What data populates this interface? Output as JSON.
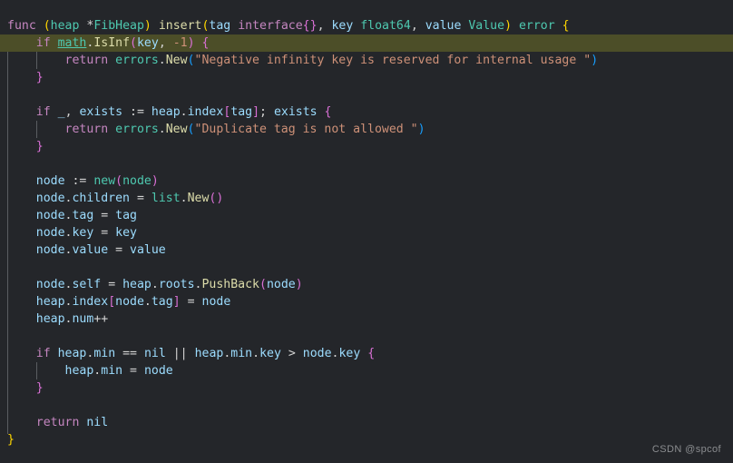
{
  "editor": {
    "language": "go",
    "background_color": "#24262a",
    "highlight_line_color": "#4c4e28",
    "highlighted_line_number": 2,
    "indent_guide_color": "#5a5d61",
    "line_height_px": 19,
    "font_size_px": 13.2
  },
  "watermark": {
    "text": "CSDN @spcof",
    "color": "#8b8d90"
  },
  "code": {
    "full_text": "func (heap *FibHeap) insert(tag interface{}, key float64, value Value) error {\n    if math.IsInf(key, -1) {\n        return errors.New(\"Negative infinity key is reserved for internal usage \")\n    }\n\n    if _, exists := heap.index[tag]; exists {\n        return errors.New(\"Duplicate tag is not allowed \")\n    }\n\n    node := new(node)\n    node.children = list.New()\n    node.tag = tag\n    node.key = key\n    node.value = value\n\n    node.self = heap.roots.PushBack(node)\n    heap.index[node.tag] = node\n    heap.num++\n\n    if heap.min == nil || heap.min.key > node.key {\n        heap.min = node\n    }\n\n    return nil\n}",
    "lines": [
      {
        "n": 1,
        "text": "func (heap *FibHeap) insert(tag interface{}, key float64, value Value) error {",
        "tokens": [
          {
            "t": "func",
            "c": "t-kw"
          },
          {
            "t": " ",
            "c": "t-plain"
          },
          {
            "t": "(",
            "c": "t-paren"
          },
          {
            "t": "heap",
            "c": "t-type"
          },
          {
            "t": " ",
            "c": "t-plain"
          },
          {
            "t": "*",
            "c": "t-plain"
          },
          {
            "t": "FibHeap",
            "c": "t-type"
          },
          {
            "t": ")",
            "c": "t-paren"
          },
          {
            "t": " ",
            "c": "t-plain"
          },
          {
            "t": "insert",
            "c": "t-func"
          },
          {
            "t": "(",
            "c": "t-paren"
          },
          {
            "t": "tag",
            "c": "t-var"
          },
          {
            "t": " ",
            "c": "t-plain"
          },
          {
            "t": "interface",
            "c": "t-iface"
          },
          {
            "t": "{}",
            "c": "t-brace"
          },
          {
            "t": ", ",
            "c": "t-op"
          },
          {
            "t": "key",
            "c": "t-var"
          },
          {
            "t": " ",
            "c": "t-plain"
          },
          {
            "t": "float64",
            "c": "t-type"
          },
          {
            "t": ", ",
            "c": "t-op"
          },
          {
            "t": "value",
            "c": "t-var"
          },
          {
            "t": " ",
            "c": "t-plain"
          },
          {
            "t": "Value",
            "c": "t-type"
          },
          {
            "t": ")",
            "c": "t-paren"
          },
          {
            "t": " ",
            "c": "t-plain"
          },
          {
            "t": "error",
            "c": "t-type"
          },
          {
            "t": " ",
            "c": "t-plain"
          },
          {
            "t": "{",
            "c": "t-brace-y"
          }
        ]
      },
      {
        "n": 2,
        "text": "    if math.IsInf(key, -1) {",
        "highlight": true,
        "tokens": [
          {
            "t": "    ",
            "c": "t-plain"
          },
          {
            "t": "if",
            "c": "t-kw"
          },
          {
            "t": " ",
            "c": "t-plain"
          },
          {
            "t": "math",
            "c": "t-pkg-link"
          },
          {
            "t": ".",
            "c": "t-plain"
          },
          {
            "t": "IsInf",
            "c": "t-func"
          },
          {
            "t": "(",
            "c": "t-paren2"
          },
          {
            "t": "key",
            "c": "t-var"
          },
          {
            "t": ", ",
            "c": "t-op"
          },
          {
            "t": "-1",
            "c": "t-str"
          },
          {
            "t": ")",
            "c": "t-paren2"
          },
          {
            "t": " ",
            "c": "t-plain"
          },
          {
            "t": "{",
            "c": "t-brace"
          }
        ]
      },
      {
        "n": 3,
        "text": "        return errors.New(\"Negative infinity key is reserved for internal usage \")",
        "tokens": [
          {
            "t": "        ",
            "c": "t-plain"
          },
          {
            "t": "return",
            "c": "t-kw"
          },
          {
            "t": " ",
            "c": "t-plain"
          },
          {
            "t": "errors",
            "c": "t-type"
          },
          {
            "t": ".",
            "c": "t-plain"
          },
          {
            "t": "New",
            "c": "t-func"
          },
          {
            "t": "(",
            "c": "t-paren3"
          },
          {
            "t": "\"Negative infinity key is reserved for internal usage \"",
            "c": "t-str"
          },
          {
            "t": ")",
            "c": "t-paren3"
          }
        ]
      },
      {
        "n": 4,
        "text": "    }",
        "tokens": [
          {
            "t": "    ",
            "c": "t-plain"
          },
          {
            "t": "}",
            "c": "t-brace"
          }
        ]
      },
      {
        "n": 5,
        "text": "",
        "tokens": []
      },
      {
        "n": 6,
        "text": "    if _, exists := heap.index[tag]; exists {",
        "tokens": [
          {
            "t": "    ",
            "c": "t-plain"
          },
          {
            "t": "if",
            "c": "t-kw"
          },
          {
            "t": " ",
            "c": "t-plain"
          },
          {
            "t": "_",
            "c": "t-var"
          },
          {
            "t": ", ",
            "c": "t-op"
          },
          {
            "t": "exists",
            "c": "t-var"
          },
          {
            "t": " ",
            "c": "t-plain"
          },
          {
            "t": ":=",
            "c": "t-op"
          },
          {
            "t": " ",
            "c": "t-plain"
          },
          {
            "t": "heap",
            "c": "t-var"
          },
          {
            "t": ".",
            "c": "t-plain"
          },
          {
            "t": "index",
            "c": "t-var"
          },
          {
            "t": "[",
            "c": "t-paren2"
          },
          {
            "t": "tag",
            "c": "t-var"
          },
          {
            "t": "]",
            "c": "t-paren2"
          },
          {
            "t": "; ",
            "c": "t-op"
          },
          {
            "t": "exists",
            "c": "t-var"
          },
          {
            "t": " ",
            "c": "t-plain"
          },
          {
            "t": "{",
            "c": "t-brace"
          }
        ]
      },
      {
        "n": 7,
        "text": "        return errors.New(\"Duplicate tag is not allowed \")",
        "tokens": [
          {
            "t": "        ",
            "c": "t-plain"
          },
          {
            "t": "return",
            "c": "t-kw"
          },
          {
            "t": " ",
            "c": "t-plain"
          },
          {
            "t": "errors",
            "c": "t-type"
          },
          {
            "t": ".",
            "c": "t-plain"
          },
          {
            "t": "New",
            "c": "t-func"
          },
          {
            "t": "(",
            "c": "t-paren3"
          },
          {
            "t": "\"Duplicate tag is not allowed \"",
            "c": "t-str"
          },
          {
            "t": ")",
            "c": "t-paren3"
          }
        ]
      },
      {
        "n": 8,
        "text": "    }",
        "tokens": [
          {
            "t": "    ",
            "c": "t-plain"
          },
          {
            "t": "}",
            "c": "t-brace"
          }
        ]
      },
      {
        "n": 9,
        "text": "",
        "tokens": []
      },
      {
        "n": 10,
        "text": "    node := new(node)",
        "tokens": [
          {
            "t": "    ",
            "c": "t-plain"
          },
          {
            "t": "node",
            "c": "t-var"
          },
          {
            "t": " ",
            "c": "t-plain"
          },
          {
            "t": ":=",
            "c": "t-op"
          },
          {
            "t": " ",
            "c": "t-plain"
          },
          {
            "t": "new",
            "c": "t-type"
          },
          {
            "t": "(",
            "c": "t-paren2"
          },
          {
            "t": "node",
            "c": "t-type"
          },
          {
            "t": ")",
            "c": "t-paren2"
          }
        ]
      },
      {
        "n": 11,
        "text": "    node.children = list.New()",
        "tokens": [
          {
            "t": "    ",
            "c": "t-plain"
          },
          {
            "t": "node",
            "c": "t-var"
          },
          {
            "t": ".",
            "c": "t-plain"
          },
          {
            "t": "children",
            "c": "t-var"
          },
          {
            "t": " ",
            "c": "t-plain"
          },
          {
            "t": "=",
            "c": "t-op"
          },
          {
            "t": " ",
            "c": "t-plain"
          },
          {
            "t": "list",
            "c": "t-type"
          },
          {
            "t": ".",
            "c": "t-plain"
          },
          {
            "t": "New",
            "c": "t-func"
          },
          {
            "t": "()",
            "c": "t-paren2"
          }
        ]
      },
      {
        "n": 12,
        "text": "    node.tag = tag",
        "tokens": [
          {
            "t": "    ",
            "c": "t-plain"
          },
          {
            "t": "node",
            "c": "t-var"
          },
          {
            "t": ".",
            "c": "t-plain"
          },
          {
            "t": "tag",
            "c": "t-var"
          },
          {
            "t": " ",
            "c": "t-plain"
          },
          {
            "t": "=",
            "c": "t-op"
          },
          {
            "t": " ",
            "c": "t-plain"
          },
          {
            "t": "tag",
            "c": "t-var"
          }
        ]
      },
      {
        "n": 13,
        "text": "    node.key = key",
        "tokens": [
          {
            "t": "    ",
            "c": "t-plain"
          },
          {
            "t": "node",
            "c": "t-var"
          },
          {
            "t": ".",
            "c": "t-plain"
          },
          {
            "t": "key",
            "c": "t-var"
          },
          {
            "t": " ",
            "c": "t-plain"
          },
          {
            "t": "=",
            "c": "t-op"
          },
          {
            "t": " ",
            "c": "t-plain"
          },
          {
            "t": "key",
            "c": "t-var"
          }
        ]
      },
      {
        "n": 14,
        "text": "    node.value = value",
        "tokens": [
          {
            "t": "    ",
            "c": "t-plain"
          },
          {
            "t": "node",
            "c": "t-var"
          },
          {
            "t": ".",
            "c": "t-plain"
          },
          {
            "t": "value",
            "c": "t-var"
          },
          {
            "t": " ",
            "c": "t-plain"
          },
          {
            "t": "=",
            "c": "t-op"
          },
          {
            "t": " ",
            "c": "t-plain"
          },
          {
            "t": "value",
            "c": "t-var"
          }
        ]
      },
      {
        "n": 15,
        "text": "",
        "tokens": []
      },
      {
        "n": 16,
        "text": "    node.self = heap.roots.PushBack(node)",
        "tokens": [
          {
            "t": "    ",
            "c": "t-plain"
          },
          {
            "t": "node",
            "c": "t-var"
          },
          {
            "t": ".",
            "c": "t-plain"
          },
          {
            "t": "self",
            "c": "t-var"
          },
          {
            "t": " ",
            "c": "t-plain"
          },
          {
            "t": "=",
            "c": "t-op"
          },
          {
            "t": " ",
            "c": "t-plain"
          },
          {
            "t": "heap",
            "c": "t-var"
          },
          {
            "t": ".",
            "c": "t-plain"
          },
          {
            "t": "roots",
            "c": "t-var"
          },
          {
            "t": ".",
            "c": "t-plain"
          },
          {
            "t": "PushBack",
            "c": "t-func"
          },
          {
            "t": "(",
            "c": "t-paren2"
          },
          {
            "t": "node",
            "c": "t-var"
          },
          {
            "t": ")",
            "c": "t-paren2"
          }
        ]
      },
      {
        "n": 17,
        "text": "    heap.index[node.tag] = node",
        "tokens": [
          {
            "t": "    ",
            "c": "t-plain"
          },
          {
            "t": "heap",
            "c": "t-var"
          },
          {
            "t": ".",
            "c": "t-plain"
          },
          {
            "t": "index",
            "c": "t-var"
          },
          {
            "t": "[",
            "c": "t-paren2"
          },
          {
            "t": "node",
            "c": "t-var"
          },
          {
            "t": ".",
            "c": "t-plain"
          },
          {
            "t": "tag",
            "c": "t-var"
          },
          {
            "t": "]",
            "c": "t-paren2"
          },
          {
            "t": " ",
            "c": "t-plain"
          },
          {
            "t": "=",
            "c": "t-op"
          },
          {
            "t": " ",
            "c": "t-plain"
          },
          {
            "t": "node",
            "c": "t-var"
          }
        ]
      },
      {
        "n": 18,
        "text": "    heap.num++",
        "tokens": [
          {
            "t": "    ",
            "c": "t-plain"
          },
          {
            "t": "heap",
            "c": "t-var"
          },
          {
            "t": ".",
            "c": "t-plain"
          },
          {
            "t": "num",
            "c": "t-var"
          },
          {
            "t": "++",
            "c": "t-op"
          }
        ]
      },
      {
        "n": 19,
        "text": "",
        "tokens": []
      },
      {
        "n": 20,
        "text": "    if heap.min == nil || heap.min.key > node.key {",
        "tokens": [
          {
            "t": "    ",
            "c": "t-plain"
          },
          {
            "t": "if",
            "c": "t-kw"
          },
          {
            "t": " ",
            "c": "t-plain"
          },
          {
            "t": "heap",
            "c": "t-var"
          },
          {
            "t": ".",
            "c": "t-plain"
          },
          {
            "t": "min",
            "c": "t-var"
          },
          {
            "t": " ",
            "c": "t-plain"
          },
          {
            "t": "==",
            "c": "t-op"
          },
          {
            "t": " ",
            "c": "t-plain"
          },
          {
            "t": "nil",
            "c": "t-var"
          },
          {
            "t": " ",
            "c": "t-plain"
          },
          {
            "t": "||",
            "c": "t-op"
          },
          {
            "t": " ",
            "c": "t-plain"
          },
          {
            "t": "heap",
            "c": "t-var"
          },
          {
            "t": ".",
            "c": "t-plain"
          },
          {
            "t": "min",
            "c": "t-var"
          },
          {
            "t": ".",
            "c": "t-plain"
          },
          {
            "t": "key",
            "c": "t-var"
          },
          {
            "t": " ",
            "c": "t-plain"
          },
          {
            "t": ">",
            "c": "t-op"
          },
          {
            "t": " ",
            "c": "t-plain"
          },
          {
            "t": "node",
            "c": "t-var"
          },
          {
            "t": ".",
            "c": "t-plain"
          },
          {
            "t": "key",
            "c": "t-var"
          },
          {
            "t": " ",
            "c": "t-plain"
          },
          {
            "t": "{",
            "c": "t-brace"
          }
        ]
      },
      {
        "n": 21,
        "text": "        heap.min = node",
        "tokens": [
          {
            "t": "        ",
            "c": "t-plain"
          },
          {
            "t": "heap",
            "c": "t-var"
          },
          {
            "t": ".",
            "c": "t-plain"
          },
          {
            "t": "min",
            "c": "t-var"
          },
          {
            "t": " ",
            "c": "t-plain"
          },
          {
            "t": "=",
            "c": "t-op"
          },
          {
            "t": " ",
            "c": "t-plain"
          },
          {
            "t": "node",
            "c": "t-var"
          }
        ]
      },
      {
        "n": 22,
        "text": "    }",
        "tokens": [
          {
            "t": "    ",
            "c": "t-plain"
          },
          {
            "t": "}",
            "c": "t-brace"
          }
        ]
      },
      {
        "n": 23,
        "text": "",
        "tokens": []
      },
      {
        "n": 24,
        "text": "    return nil",
        "tokens": [
          {
            "t": "    ",
            "c": "t-plain"
          },
          {
            "t": "return",
            "c": "t-kw"
          },
          {
            "t": " ",
            "c": "t-plain"
          },
          {
            "t": "nil",
            "c": "t-var"
          }
        ]
      },
      {
        "n": 25,
        "text": "}",
        "tokens": [
          {
            "t": "}",
            "c": "t-brace-y"
          }
        ]
      }
    ]
  }
}
